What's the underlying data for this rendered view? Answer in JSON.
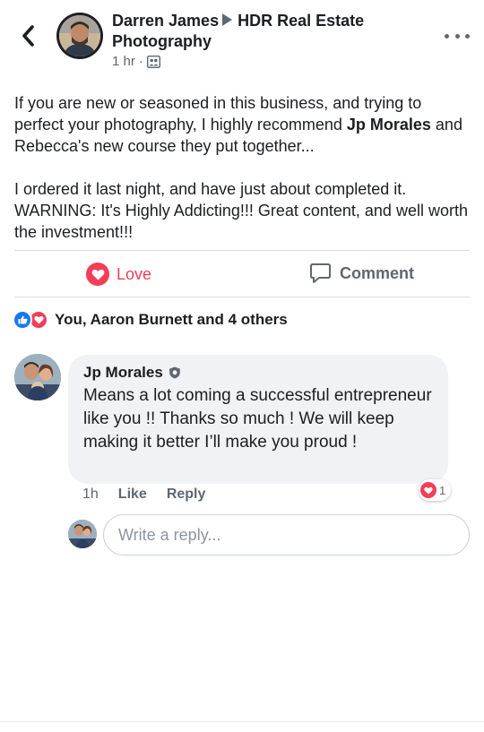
{
  "header": {
    "author": "Darren James",
    "group": "HDR Real Estate Photography",
    "time": "1 hr",
    "separator": "·",
    "audience_icon": "group-audience-icon",
    "back_icon": "chevron-left-icon",
    "more_icon": "more-dots-icon"
  },
  "post": {
    "paragraph1_before": "If you are new or seasoned in this business, and trying to perfect your photography, I highly recommend ",
    "paragraph1_mention": "Jp Morales",
    "paragraph1_after": " and Rebecca's new course they put together...",
    "paragraph2": "I ordered it last night, and have just about completed it. WARNING:  It's Highly Addicting!!!  Great content, and well worth the investment!!!"
  },
  "actions": {
    "love_label": "Love",
    "comment_label": "Comment"
  },
  "reactions": {
    "summary": "You, Aaron Burnett and 4 others",
    "types": [
      "like",
      "love"
    ]
  },
  "comment": {
    "author": "Jp Morales",
    "badge_icon": "group-admin-shield-icon",
    "text": "Means a lot coming a successful entrepreneur like you !! Thanks so much ! We will keep making it better I’ll make you proud !",
    "time": "1h",
    "like_label": "Like",
    "reply_label": "Reply",
    "reaction_count": "1"
  },
  "reply": {
    "placeholder": "Write a reply..."
  },
  "colors": {
    "love": "#f33e58",
    "like": "#1877f2",
    "secondary_text": "#606770",
    "bubble": "#f0f2f5"
  }
}
